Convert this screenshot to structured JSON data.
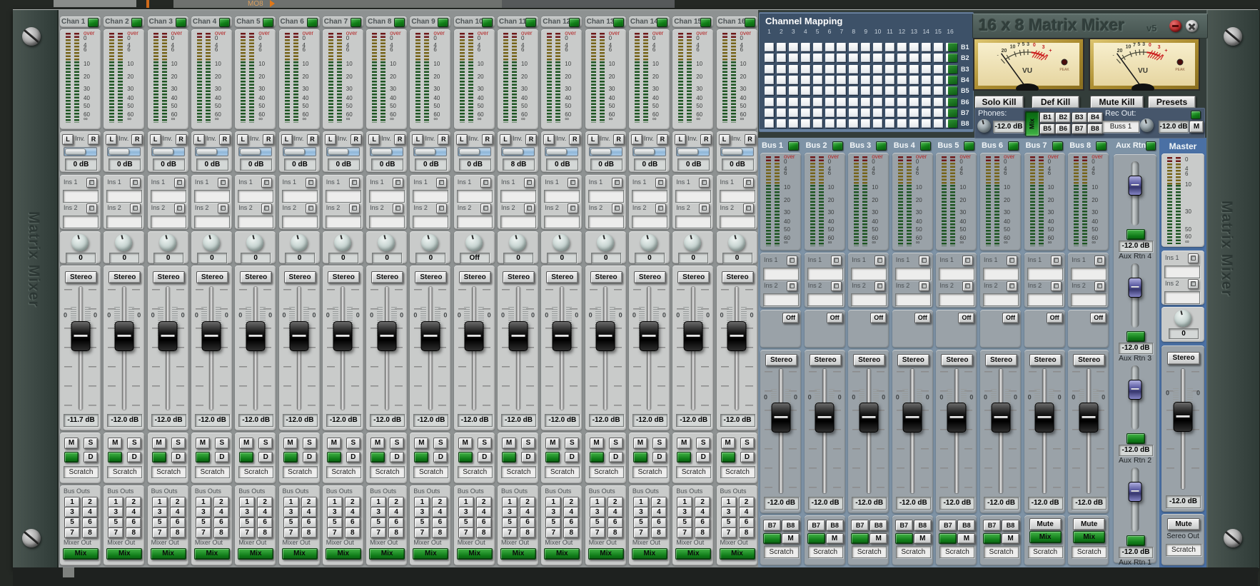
{
  "window": {
    "title": "16 x 8 Matrix Mixer",
    "version": "v5",
    "rack_label_left": "Matrix Mixer",
    "rack_label_right": "Matrix Mixer",
    "background": {
      "app_label": "MO8"
    }
  },
  "ui": {
    "fader_zero": "0"
  },
  "channels": {
    "meter_scale": [
      "over",
      "0",
      "4",
      "6",
      "10",
      "20",
      "30",
      "40",
      "50",
      "60",
      "∞"
    ],
    "labels": {
      "left": "L",
      "inv": "Inv.",
      "right": "R",
      "ins1": "Ins 1",
      "ins2": "Ins 2",
      "stereo": "Stereo",
      "mute": "M",
      "solo": "S",
      "direct": "D",
      "scratch": "Scratch",
      "bus_outs": "Bus Outs",
      "mixer_out": "Mixer Out",
      "mix": "Mix",
      "bus_numbers": [
        "1",
        "2",
        "3",
        "4",
        "5",
        "6",
        "7",
        "8"
      ]
    },
    "items": [
      {
        "name": "Chan 1",
        "pan_db": "0 dB",
        "knob": "0",
        "fader_db": "-11.7 dB"
      },
      {
        "name": "Chan 2",
        "pan_db": "0 dB",
        "knob": "0",
        "fader_db": "-12.0 dB"
      },
      {
        "name": "Chan 3",
        "pan_db": "0 dB",
        "knob": "0",
        "fader_db": "-12.0 dB"
      },
      {
        "name": "Chan 4",
        "pan_db": "0 dB",
        "knob": "0",
        "fader_db": "-12.0 dB"
      },
      {
        "name": "Chan 5",
        "pan_db": "0 dB",
        "knob": "0",
        "fader_db": "-12.0 dB"
      },
      {
        "name": "Chan 6",
        "pan_db": "0 dB",
        "knob": "0",
        "fader_db": "-12.0 dB"
      },
      {
        "name": "Chan 7",
        "pan_db": "0 dB",
        "knob": "0",
        "fader_db": "-12.0 dB"
      },
      {
        "name": "Chan 8",
        "pan_db": "0 dB",
        "knob": "0",
        "fader_db": "-12.0 dB"
      },
      {
        "name": "Chan 9",
        "pan_db": "0 dB",
        "knob": "0",
        "fader_db": "-12.0 dB"
      },
      {
        "name": "Chan 10",
        "pan_db": "0 dB",
        "knob": "Off",
        "fader_db": "-12.0 dB"
      },
      {
        "name": "Chan 11",
        "pan_db": "8 dB",
        "knob": "0",
        "fader_db": "-12.0 dB"
      },
      {
        "name": "Chan 12",
        "pan_db": "0 dB",
        "knob": "0",
        "fader_db": "-12.0 dB"
      },
      {
        "name": "Chan 13",
        "pan_db": "0 dB",
        "knob": "0",
        "fader_db": "-12.0 dB"
      },
      {
        "name": "Chan 14",
        "pan_db": "0 dB",
        "knob": "0",
        "fader_db": "-12.0 dB"
      },
      {
        "name": "Chan 15",
        "pan_db": "0 dB",
        "knob": "0",
        "fader_db": "-12.0 dB"
      },
      {
        "name": "Chan 16",
        "pan_db": "0 dB",
        "knob": "0",
        "fader_db": "-12.0 dB"
      }
    ]
  },
  "matrix": {
    "title": "Channel Mapping",
    "columns": [
      "1",
      "2",
      "3",
      "4",
      "5",
      "6",
      "7",
      "8",
      "9",
      "10",
      "11",
      "12",
      "13",
      "14",
      "15",
      "16"
    ],
    "rows": [
      "B1",
      "B2",
      "B3",
      "B4",
      "B5",
      "B6",
      "B7",
      "B8"
    ]
  },
  "vu": {
    "scale": [
      "20",
      "10",
      "7",
      "5",
      "3",
      "0",
      "3"
    ],
    "minus": "-",
    "plus": "+",
    "label": "VU",
    "peak": "PEAK"
  },
  "controls": {
    "solo_kill": "Solo Kill",
    "def_kill": "Def Kill",
    "mute_kill": "Mute Kill",
    "presets": "Presets",
    "phones_label": "Phones:",
    "phones_db": "-12.0 dB",
    "mix": "Mix",
    "bus_select": [
      "B1",
      "B2",
      "B3",
      "B4",
      "B5",
      "B6",
      "B7",
      "B8"
    ],
    "rec_out_label": "Rec Out:",
    "rec_out_value": "Buss 1",
    "rec_out_db": "-12.0 dB",
    "mono": "M"
  },
  "buses": {
    "meter_scale": [
      "over",
      "0",
      "4",
      "6",
      "10",
      "20",
      "30",
      "40",
      "50",
      "60",
      "∞"
    ],
    "labels": {
      "ins1": "Ins 1",
      "ins2": "Ins 2",
      "off": "Off",
      "stereo": "Stereo",
      "b7": "B7",
      "b8": "B8",
      "m": "M",
      "mute": "Mute",
      "mix": "Mix",
      "scratch": "Scratch"
    },
    "items": [
      {
        "name": "Bus 1",
        "fader_db": "-12.0 dB",
        "bottom": "route"
      },
      {
        "name": "Bus 2",
        "fader_db": "-12.0 dB",
        "bottom": "route"
      },
      {
        "name": "Bus 3",
        "fader_db": "-12.0 dB",
        "bottom": "route"
      },
      {
        "name": "Bus 4",
        "fader_db": "-12.0 dB",
        "bottom": "route"
      },
      {
        "name": "Bus 5",
        "fader_db": "-12.0 dB",
        "bottom": "route"
      },
      {
        "name": "Bus 6",
        "fader_db": "-12.0 dB",
        "bottom": "route"
      },
      {
        "name": "Bus 7",
        "fader_db": "-12.0 dB",
        "bottom": "mix"
      },
      {
        "name": "Bus 8",
        "fader_db": "-12.0 dB",
        "bottom": "mix"
      }
    ]
  },
  "aux": {
    "title": "Aux Rtns",
    "items": [
      {
        "label": "Aux Rtn 4",
        "db": "-12.0 dB"
      },
      {
        "label": "Aux Rtn 3",
        "db": "-12.0 dB"
      },
      {
        "label": "Aux Rtn 2",
        "db": "-12.0 dB"
      },
      {
        "label": "Aux Rtn 1",
        "db": "-12.0 dB"
      }
    ]
  },
  "master": {
    "title": "Master",
    "meter_scale": [
      "0",
      "4",
      "6",
      "10",
      "30",
      "50",
      "60",
      "∞"
    ],
    "ins1": "Ins 1",
    "ins2": "Ins 2",
    "knob": "0",
    "stereo": "Stereo",
    "fader_db": "-12.0 dB",
    "mute": "Mute",
    "out_label": "Sereo Out",
    "scratch": "Scratch"
  }
}
